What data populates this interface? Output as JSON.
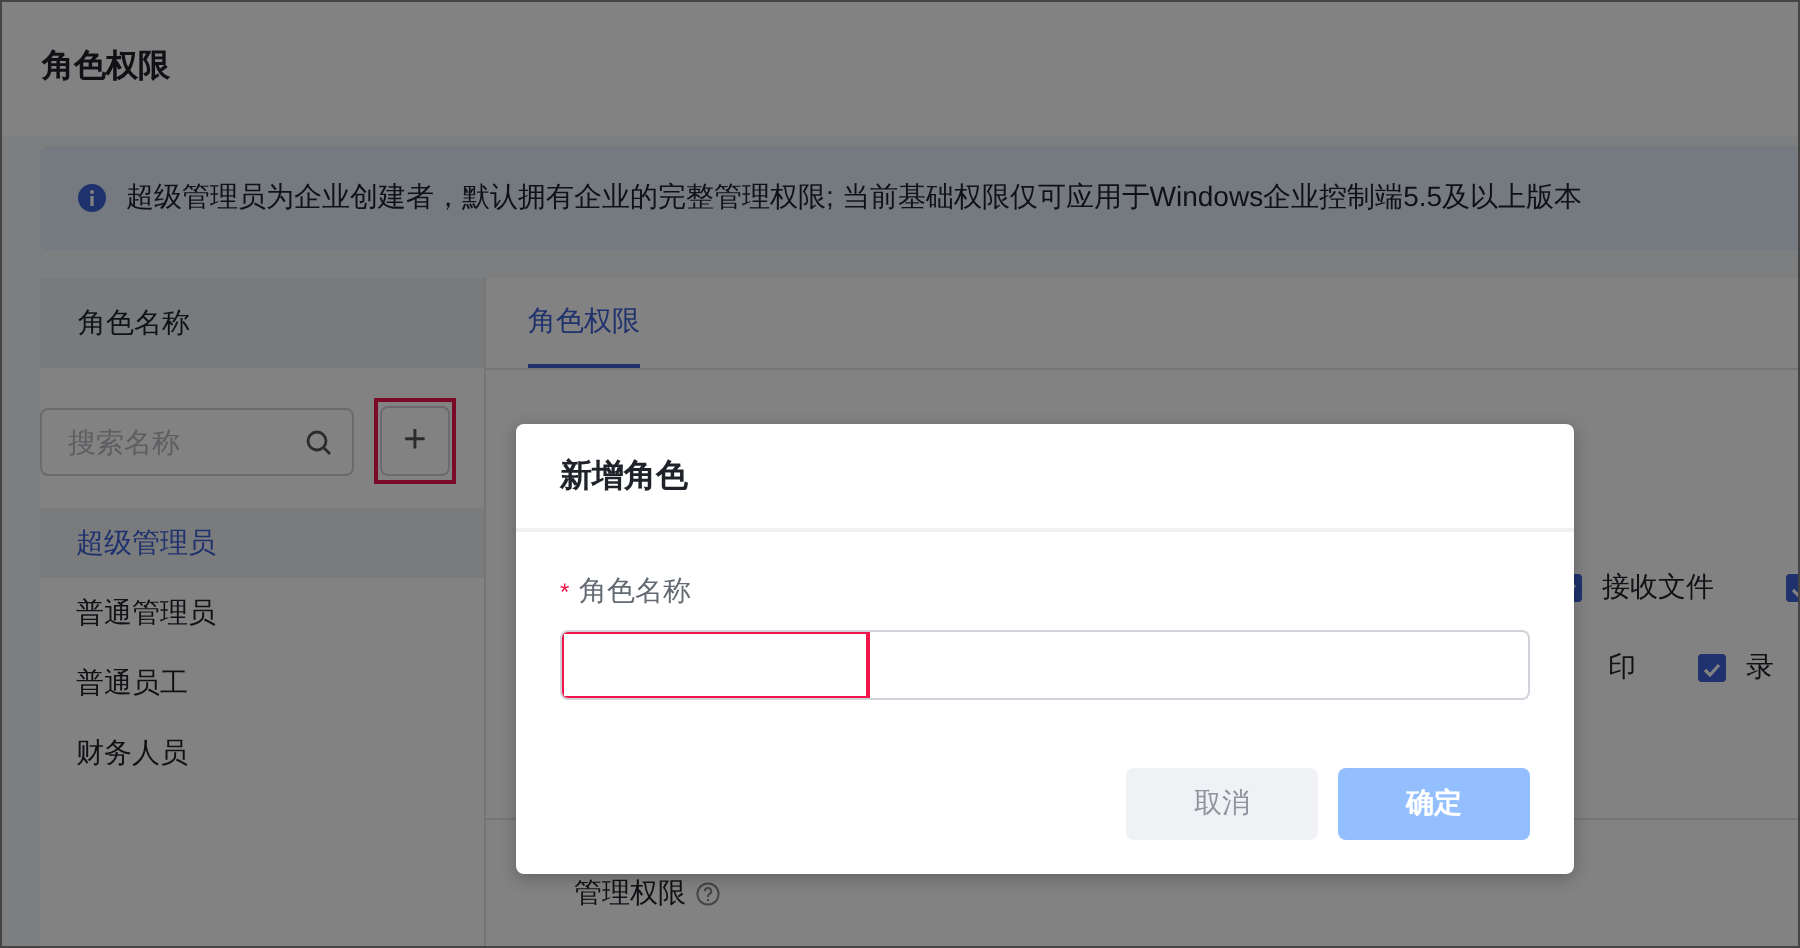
{
  "page": {
    "title": "角色权限"
  },
  "notice": {
    "text": "超级管理员为企业创建者，默认拥有企业的完整管理权限; 当前基础权限仅可应用于Windows企业控制端5.5及以上版本"
  },
  "role_panel": {
    "header": "角色名称",
    "search": {
      "placeholder": "搜索名称"
    },
    "add_button": {
      "label": "+",
      "highlighted": true
    },
    "roles": [
      {
        "name": "超级管理员",
        "selected": true
      },
      {
        "name": "普通管理员",
        "selected": false
      },
      {
        "name": "普通员工",
        "selected": false
      },
      {
        "name": "财务人员",
        "selected": false
      }
    ]
  },
  "tabs": [
    {
      "label": "角色权限",
      "selected": true
    }
  ],
  "permission_rows": [
    [
      {
        "label": "接收文件",
        "checked": true
      },
      {
        "checked": true
      }
    ],
    [
      {
        "label": "印"
      },
      {
        "label": "录",
        "checked": true
      }
    ]
  ],
  "section": {
    "title": "管理权限"
  },
  "dialog": {
    "title": "新增角色",
    "field": {
      "required_mark": "*",
      "label": "角色名称",
      "highlighted": true
    },
    "buttons": [
      {
        "label": "取消",
        "kind": "secondary",
        "disabled": false
      },
      {
        "label": "确定",
        "kind": "primary",
        "disabled": true
      }
    ]
  }
}
